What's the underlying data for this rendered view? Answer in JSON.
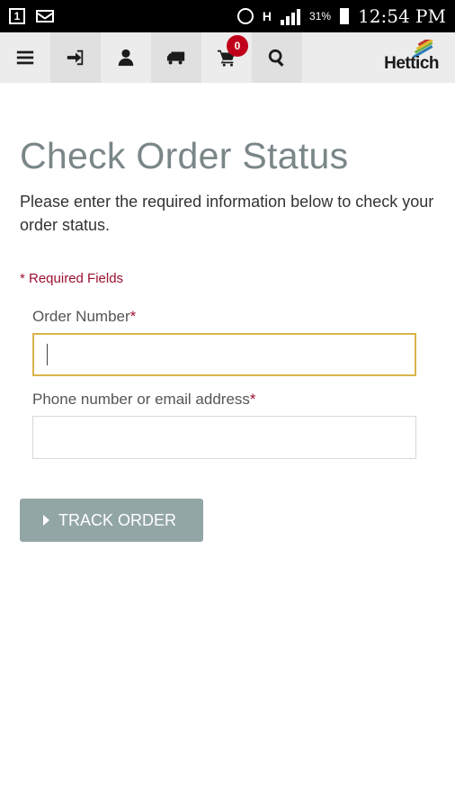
{
  "status_bar": {
    "notification_badge": "1",
    "battery_percent": "31%",
    "time": "12:54 PM",
    "network_type": "H"
  },
  "navbar": {
    "cart_count": "0",
    "logo_text": "Hettich",
    "icons": [
      "menu-icon",
      "sign-in-icon",
      "user-icon",
      "truck-icon",
      "cart-icon",
      "search-icon"
    ]
  },
  "page": {
    "title": "Check Order Status",
    "intro": "Please enter the required information below to check your order status.",
    "required_note": "* Required Fields",
    "order_number_label": "Order Number",
    "contact_label": "Phone number or email address",
    "required_star": "*",
    "track_button_label": "TRACK ORDER"
  },
  "colors": {
    "accent_red": "#9b1030",
    "focus_border": "#d9b44a",
    "button_bg": "#93a6a6",
    "title_gray": "#7a8688"
  }
}
